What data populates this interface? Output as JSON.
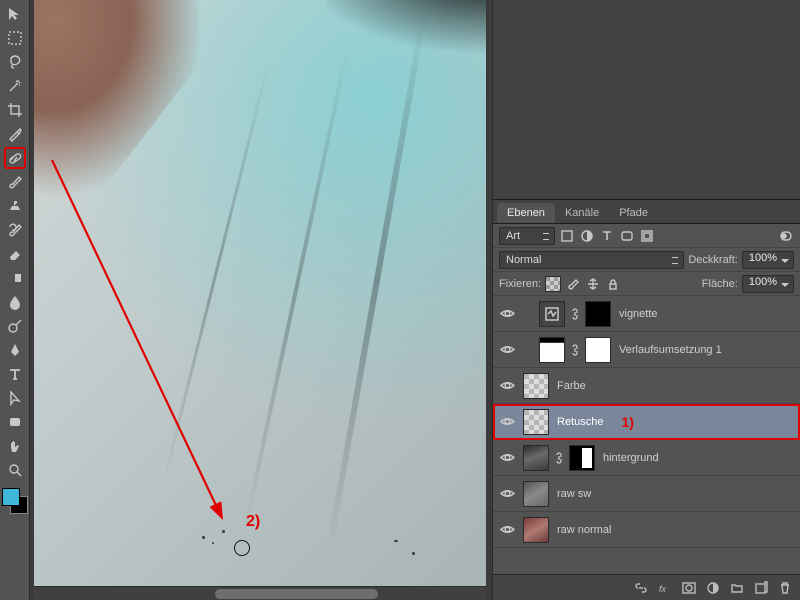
{
  "tools": [
    {
      "name": "move-tool"
    },
    {
      "name": "marquee-tool"
    },
    {
      "name": "lasso-tool"
    },
    {
      "name": "magic-wand-tool"
    },
    {
      "name": "crop-tool"
    },
    {
      "name": "eyedropper-tool"
    },
    {
      "name": "healing-brush-tool",
      "selected": true
    },
    {
      "name": "brush-tool"
    },
    {
      "name": "clone-stamp-tool"
    },
    {
      "name": "history-brush-tool"
    },
    {
      "name": "eraser-tool"
    },
    {
      "name": "gradient-tool"
    },
    {
      "name": "blur-tool"
    },
    {
      "name": "dodge-tool"
    },
    {
      "name": "pen-tool"
    },
    {
      "name": "type-tool"
    },
    {
      "name": "path-selection-tool"
    },
    {
      "name": "shape-tool"
    },
    {
      "name": "hand-tool"
    },
    {
      "name": "zoom-tool"
    }
  ],
  "swatch": {
    "fg": "#3fb8d8",
    "bg": "#000000"
  },
  "panels": {
    "tabs": [
      {
        "label": "Ebenen",
        "active": true
      },
      {
        "label": "Kanäle",
        "active": false
      },
      {
        "label": "Pfade",
        "active": false
      }
    ],
    "filter_label": "Art",
    "blend_mode": "Normal",
    "opacity_label": "Deckkraft:",
    "opacity_value": "100%",
    "lock_label": "Fixieren:",
    "fill_label": "Fläche:",
    "fill_value": "100%"
  },
  "layers": [
    {
      "name": "vignette",
      "indent": true,
      "thumbs": [
        "adj",
        "link",
        "black"
      ]
    },
    {
      "name": "Verlaufsumsetzung 1",
      "indent": true,
      "thumbs": [
        "gradient",
        "link",
        "white"
      ]
    },
    {
      "name": "Farbe",
      "thumbs": [
        "checker"
      ]
    },
    {
      "name": "Retusche",
      "thumbs": [
        "checker"
      ],
      "selected": true,
      "highlight": true,
      "annot": "1)"
    },
    {
      "name": "hintergrund",
      "thumbs": [
        "photo1",
        "link",
        "mask1"
      ]
    },
    {
      "name": "raw sw",
      "thumbs": [
        "photo2"
      ]
    },
    {
      "name": "raw normal",
      "thumbs": [
        "photo3"
      ]
    }
  ],
  "annotations": {
    "arrow_label": "2)"
  },
  "footer_icons": [
    "link-icon",
    "fx-icon",
    "mask-icon",
    "adjustment-icon",
    "group-icon",
    "new-layer-icon",
    "trash-icon"
  ]
}
